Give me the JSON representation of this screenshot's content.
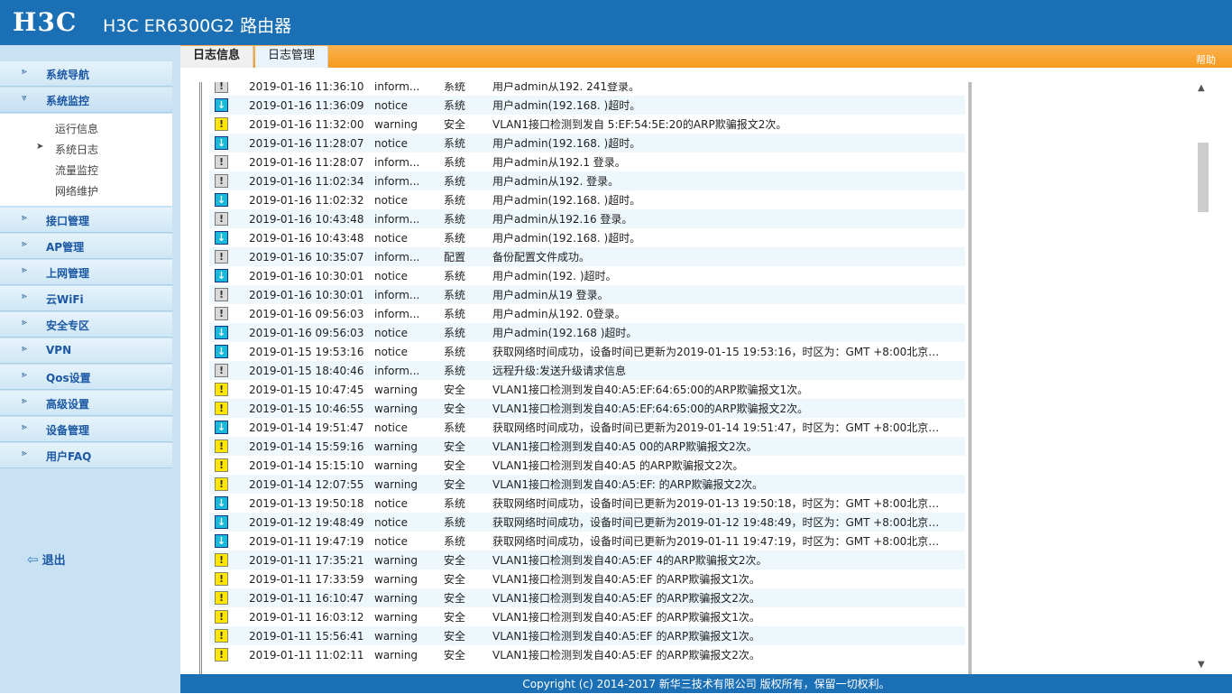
{
  "header": {
    "logo": "H3C",
    "title": "H3C ER6300G2 路由器"
  },
  "sidebar": {
    "items_before": [
      {
        "label": "系统导航"
      }
    ],
    "active": {
      "label": "系统监控",
      "sub": [
        {
          "label": "运行信息",
          "bullet": ""
        },
        {
          "label": "系统日志",
          "bullet": "➤"
        },
        {
          "label": "流量监控",
          "bullet": ""
        },
        {
          "label": "网络维护",
          "bullet": ""
        }
      ]
    },
    "items_after": [
      {
        "label": "接口管理"
      },
      {
        "label": "AP管理"
      },
      {
        "label": "上网管理"
      },
      {
        "label": "云WiFi"
      },
      {
        "label": "安全专区"
      },
      {
        "label": "VPN"
      },
      {
        "label": "Qos设置"
      },
      {
        "label": "高级设置"
      },
      {
        "label": "设备管理"
      },
      {
        "label": "用户FAQ"
      }
    ],
    "logout": "退出"
  },
  "tabs": [
    {
      "label": "日志信息"
    },
    {
      "label": "日志管理"
    }
  ],
  "help": "帮助",
  "logs": [
    {
      "level": "inform...",
      "icon": "info",
      "time": "2019-01-16 11:36:10",
      "type": "系统",
      "msg": "用户admin从192.        241登录。"
    },
    {
      "level": "notice",
      "icon": "notice",
      "time": "2019-01-16 11:36:09",
      "type": "系统",
      "msg": "用户admin(192.168.     )超时。"
    },
    {
      "level": "warning",
      "icon": "warning",
      "time": "2019-01-16 11:32:00",
      "type": "安全",
      "msg": "VLAN1接口检测到发自     5:EF:54:5E:20的ARP欺骗报文2次。"
    },
    {
      "level": "notice",
      "icon": "notice",
      "time": "2019-01-16 11:28:07",
      "type": "系统",
      "msg": "用户admin(192.168.     )超时。"
    },
    {
      "level": "inform...",
      "icon": "info",
      "time": "2019-01-16 11:28:07",
      "type": "系统",
      "msg": "用户admin从192.1        登录。"
    },
    {
      "level": "inform...",
      "icon": "info",
      "time": "2019-01-16 11:02:34",
      "type": "系统",
      "msg": "用户admin从192.        登录。"
    },
    {
      "level": "notice",
      "icon": "notice",
      "time": "2019-01-16 11:02:32",
      "type": "系统",
      "msg": "用户admin(192.168.     )超时。"
    },
    {
      "level": "inform...",
      "icon": "info",
      "time": "2019-01-16 10:43:48",
      "type": "系统",
      "msg": "用户admin从192.16       登录。"
    },
    {
      "level": "notice",
      "icon": "notice",
      "time": "2019-01-16 10:43:48",
      "type": "系统",
      "msg": "用户admin(192.168.     )超时。"
    },
    {
      "level": "inform...",
      "icon": "info",
      "time": "2019-01-16 10:35:07",
      "type": "配置",
      "msg": "备份配置文件成功。"
    },
    {
      "level": "notice",
      "icon": "notice",
      "time": "2019-01-16 10:30:01",
      "type": "系统",
      "msg": "用户admin(192.        )超时。"
    },
    {
      "level": "inform...",
      "icon": "info",
      "time": "2019-01-16 10:30:01",
      "type": "系统",
      "msg": "用户admin从19        登录。"
    },
    {
      "level": "inform...",
      "icon": "info",
      "time": "2019-01-16 09:56:03",
      "type": "系统",
      "msg": "用户admin从192.        0登录。"
    },
    {
      "level": "notice",
      "icon": "notice",
      "time": "2019-01-16 09:56:03",
      "type": "系统",
      "msg": "用户admin(192.168     )超时。"
    },
    {
      "level": "notice",
      "icon": "notice",
      "time": "2019-01-15 19:53:16",
      "type": "系统",
      "msg": "获取网络时间成功，设备时间已更新为2019-01-15 19:53:16，时区为：GMT +8:00北京…"
    },
    {
      "level": "inform...",
      "icon": "info",
      "time": "2019-01-15 18:40:46",
      "type": "系统",
      "msg": "远程升级:发送升级请求信息"
    },
    {
      "level": "warning",
      "icon": "warning",
      "time": "2019-01-15 10:47:45",
      "type": "安全",
      "msg": "VLAN1接口检测到发自40:A5:EF:64:65:00的ARP欺骗报文1次。"
    },
    {
      "level": "warning",
      "icon": "warning",
      "time": "2019-01-15 10:46:55",
      "type": "安全",
      "msg": "VLAN1接口检测到发自40:A5:EF:64:65:00的ARP欺骗报文2次。"
    },
    {
      "level": "notice",
      "icon": "notice",
      "time": "2019-01-14 19:51:47",
      "type": "系统",
      "msg": "获取网络时间成功，设备时间已更新为2019-01-14 19:51:47，时区为：GMT +8:00北京…"
    },
    {
      "level": "warning",
      "icon": "warning",
      "time": "2019-01-14 15:59:16",
      "type": "安全",
      "msg": "VLAN1接口检测到发自40:A5        00的ARP欺骗报文2次。"
    },
    {
      "level": "warning",
      "icon": "warning",
      "time": "2019-01-14 15:15:10",
      "type": "安全",
      "msg": "VLAN1接口检测到发自40:A5        的ARP欺骗报文2次。"
    },
    {
      "level": "warning",
      "icon": "warning",
      "time": "2019-01-14 12:07:55",
      "type": "安全",
      "msg": "VLAN1接口检测到发自40:A5:EF:        的ARP欺骗报文2次。"
    },
    {
      "level": "notice",
      "icon": "notice",
      "time": "2019-01-13 19:50:18",
      "type": "系统",
      "msg": "获取网络时间成功，设备时间已更新为2019-01-13 19:50:18，时区为：GMT +8:00北京…"
    },
    {
      "level": "notice",
      "icon": "notice",
      "time": "2019-01-12 19:48:49",
      "type": "系统",
      "msg": "获取网络时间成功，设备时间已更新为2019-01-12 19:48:49，时区为：GMT +8:00北京…"
    },
    {
      "level": "notice",
      "icon": "notice",
      "time": "2019-01-11 19:47:19",
      "type": "系统",
      "msg": "获取网络时间成功，设备时间已更新为2019-01-11 19:47:19，时区为：GMT +8:00北京…"
    },
    {
      "level": "warning",
      "icon": "warning",
      "time": "2019-01-11 17:35:21",
      "type": "安全",
      "msg": "VLAN1接口检测到发自40:A5:EF        4的ARP欺骗报文2次。"
    },
    {
      "level": "warning",
      "icon": "warning",
      "time": "2019-01-11 17:33:59",
      "type": "安全",
      "msg": "VLAN1接口检测到发自40:A5:EF        的ARP欺骗报文1次。"
    },
    {
      "level": "warning",
      "icon": "warning",
      "time": "2019-01-11 16:10:47",
      "type": "安全",
      "msg": "VLAN1接口检测到发自40:A5:EF        的ARP欺骗报文2次。"
    },
    {
      "level": "warning",
      "icon": "warning",
      "time": "2019-01-11 16:03:12",
      "type": "安全",
      "msg": "VLAN1接口检测到发自40:A5:EF        的ARP欺骗报文1次。"
    },
    {
      "level": "warning",
      "icon": "warning",
      "time": "2019-01-11 15:56:41",
      "type": "安全",
      "msg": "VLAN1接口检测到发自40:A5:EF        的ARP欺骗报文1次。"
    },
    {
      "level": "warning",
      "icon": "warning",
      "time": "2019-01-11 11:02:11",
      "type": "安全",
      "msg": "VLAN1接口检测到发自40:A5:EF        的ARP欺骗报文2次。"
    }
  ],
  "footer": "Copyright (c) 2014-2017 新华三技术有限公司 版权所有，保留一切权利。"
}
